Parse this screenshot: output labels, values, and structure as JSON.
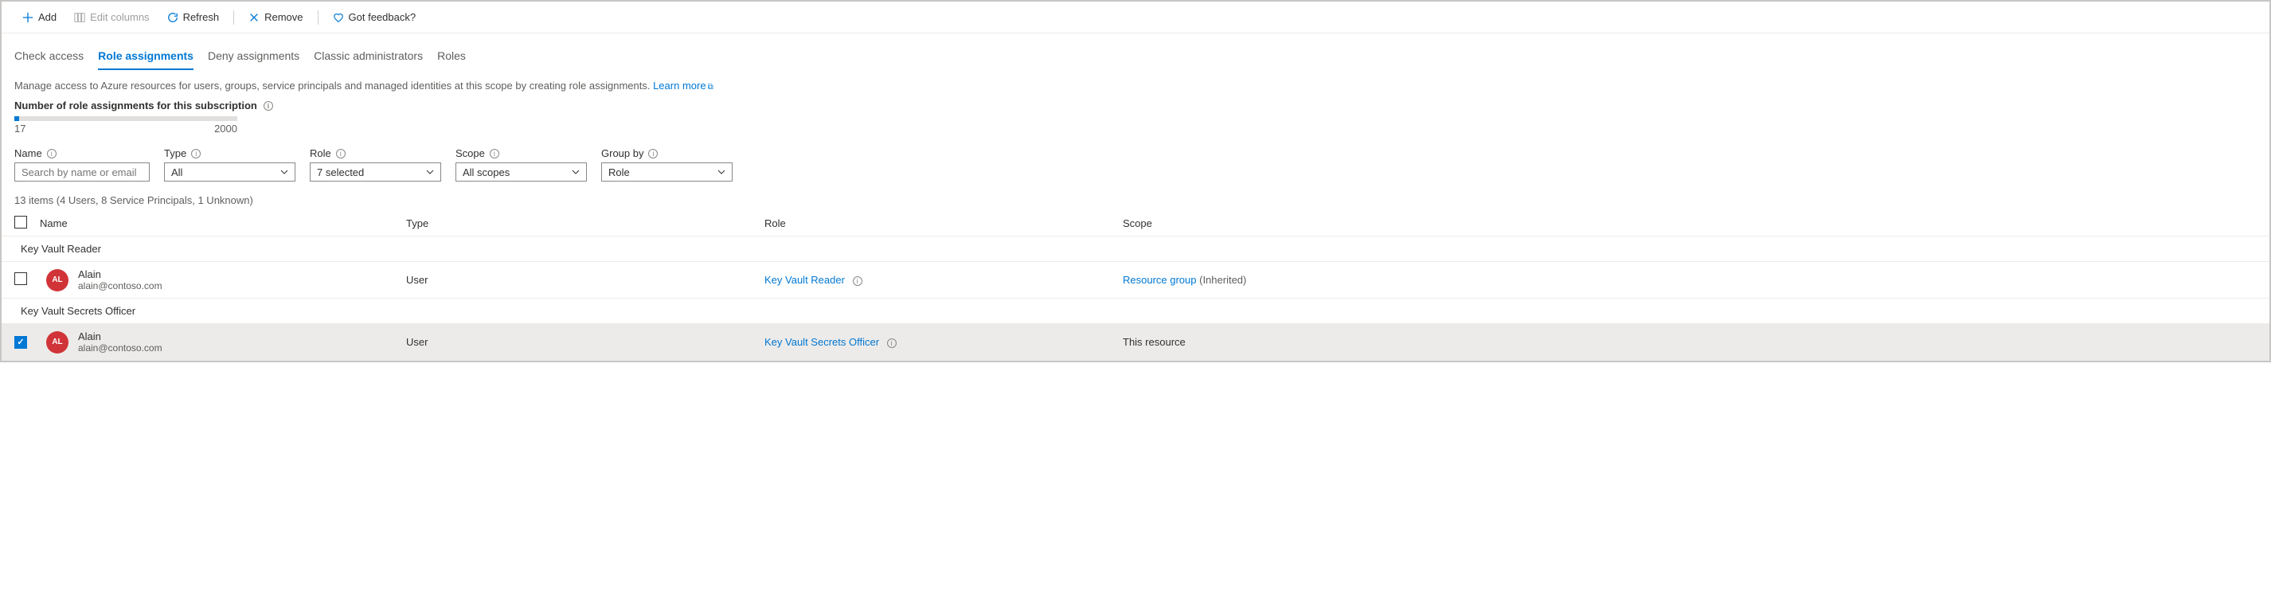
{
  "toolbar": {
    "add": "Add",
    "editColumns": "Edit columns",
    "refresh": "Refresh",
    "remove": "Remove",
    "feedback": "Got feedback?"
  },
  "tabs": {
    "checkAccess": "Check access",
    "roleAssignments": "Role assignments",
    "denyAssignments": "Deny assignments",
    "classicAdmins": "Classic administrators",
    "roles": "Roles"
  },
  "description": {
    "text": "Manage access to Azure resources for users, groups, service principals and managed identities at this scope by creating role assignments. ",
    "learnMore": "Learn more"
  },
  "count": {
    "label": "Number of role assignments for this subscription",
    "current": "17",
    "max": "2000"
  },
  "filters": {
    "name": {
      "label": "Name",
      "placeholder": "Search by name or email"
    },
    "type": {
      "label": "Type",
      "value": "All"
    },
    "role": {
      "label": "Role",
      "value": "7 selected"
    },
    "scope": {
      "label": "Scope",
      "value": "All scopes"
    },
    "groupBy": {
      "label": "Group by",
      "value": "Role"
    }
  },
  "summary": "13 items (4 Users, 8 Service Principals, 1 Unknown)",
  "headers": {
    "name": "Name",
    "type": "Type",
    "role": "Role",
    "scope": "Scope"
  },
  "groups": [
    {
      "name": "Key Vault Reader",
      "rows": [
        {
          "checked": false,
          "initials": "AL",
          "displayName": "Alain",
          "email": "alain@contoso.com",
          "type": "User",
          "role": "Key Vault Reader",
          "scopeLink": "Resource group",
          "scopeSuffix": " (Inherited)"
        }
      ]
    },
    {
      "name": "Key Vault Secrets Officer",
      "rows": [
        {
          "checked": true,
          "initials": "AL",
          "displayName": "Alain",
          "email": "alain@contoso.com",
          "type": "User",
          "role": "Key Vault Secrets Officer",
          "scopeText": "This resource"
        }
      ]
    }
  ]
}
